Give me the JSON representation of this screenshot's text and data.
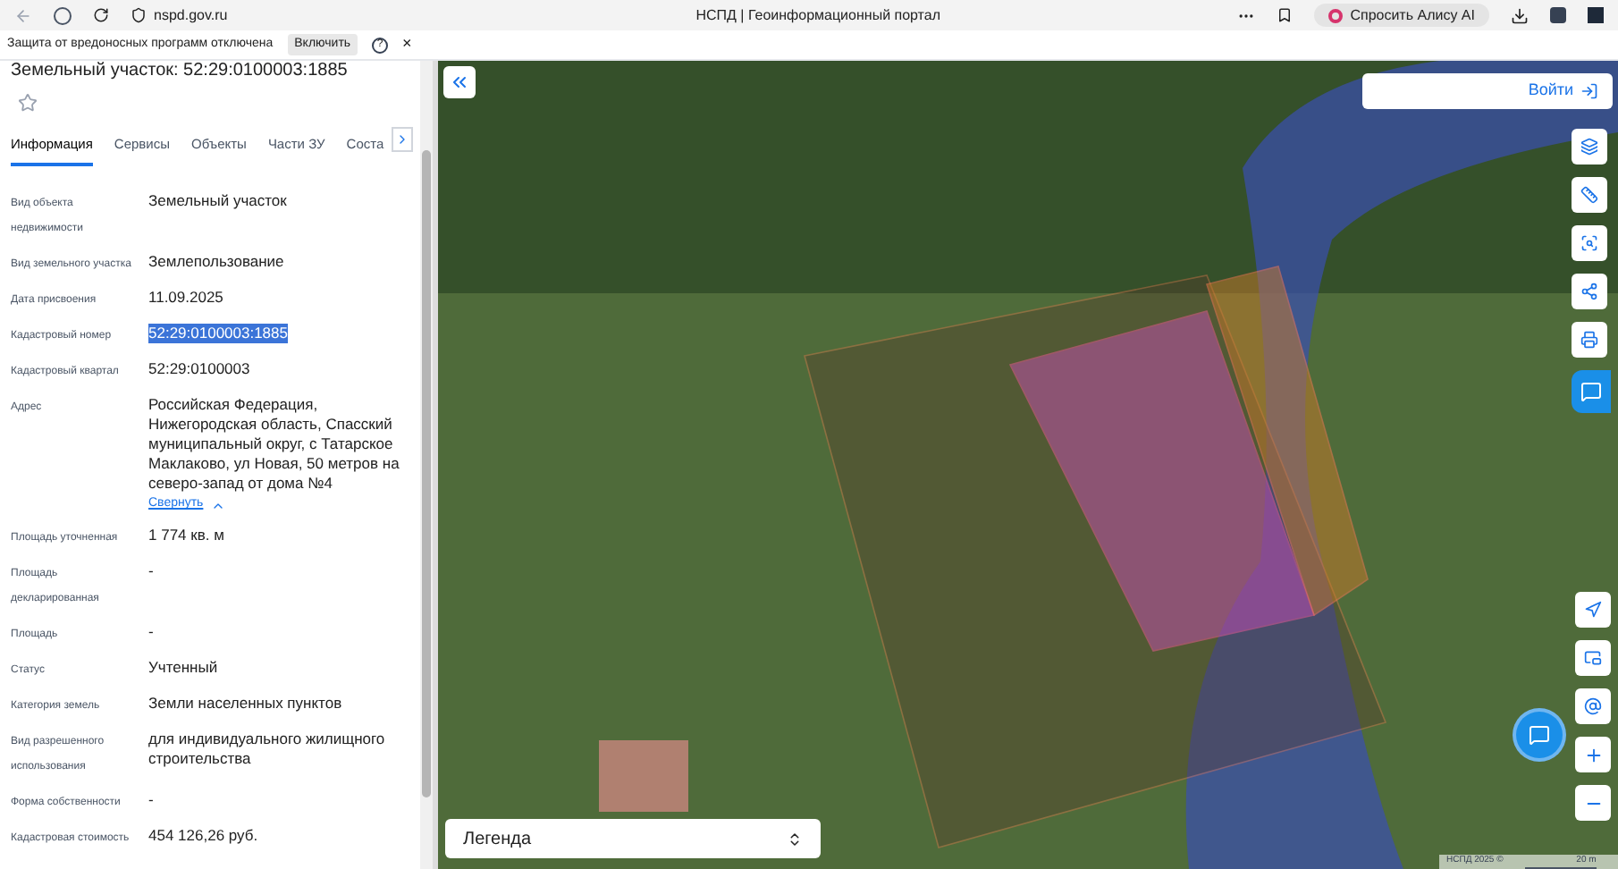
{
  "browser": {
    "url": "nspd.gov.ru",
    "title": "НСПД | Геоинформационный портал",
    "alice_button": "Спросить Алису AI"
  },
  "infobar": {
    "message": "Защита от вредоносных программ отключена",
    "button": "Включить",
    "help": "?",
    "close": "×"
  },
  "panel": {
    "title": "Земельный участок: 52:29:0100003:1885",
    "favorite": false,
    "tabs": [
      {
        "label": "Информация",
        "selected": true
      },
      {
        "label": "Сервисы",
        "selected": false
      },
      {
        "label": "Объекты",
        "selected": false
      },
      {
        "label": "Части ЗУ",
        "selected": false
      },
      {
        "label": "Соста",
        "selected": false
      }
    ],
    "fields": [
      {
        "label": "Вид объекта недвижимости",
        "value": "Земельный участок",
        "highlighted": false
      },
      {
        "label": "Вид земельного участка",
        "value": "Землепользование",
        "highlighted": false
      },
      {
        "label": "Дата присвоения",
        "value": "11.09.2025",
        "highlighted": false
      },
      {
        "label": "Кадастровый номер",
        "value": "52:29:0100003:1885",
        "highlighted": true
      },
      {
        "label": "Кадастровый квартал",
        "value": "52:29:0100003",
        "highlighted": false
      },
      {
        "label": "Адрес",
        "value": "Российская Федерация, Нижегородская область, Спасский муниципальный округ, с Татарское Маклаково, ул Новая, 50 метров на северо-запад от дома №4",
        "highlighted": false,
        "link": "Свернуть"
      },
      {
        "label": "Площадь уточненная",
        "value": "1 774 кв. м",
        "highlighted": false
      },
      {
        "label": "Площадь декларированная",
        "value": "-",
        "highlighted": false
      },
      {
        "label": "Площадь",
        "value": "-",
        "highlighted": false
      },
      {
        "label": "Статус",
        "value": "Учтенный",
        "highlighted": false
      },
      {
        "label": "Категория земель",
        "value": "Земли населенных пунктов",
        "highlighted": false
      },
      {
        "label": "Вид разрешенного использования",
        "value": "для индивидуального жилищного строительства",
        "highlighted": false
      },
      {
        "label": "Форма собственности",
        "value": "-",
        "highlighted": false
      },
      {
        "label": "Кадастровая стоимость",
        "value": "454 126,26 руб.",
        "highlighted": false
      }
    ]
  },
  "map": {
    "login": "Войти",
    "legend": "Легенда",
    "attribution": "НСПД 2025 ©",
    "scale": "20 m"
  }
}
